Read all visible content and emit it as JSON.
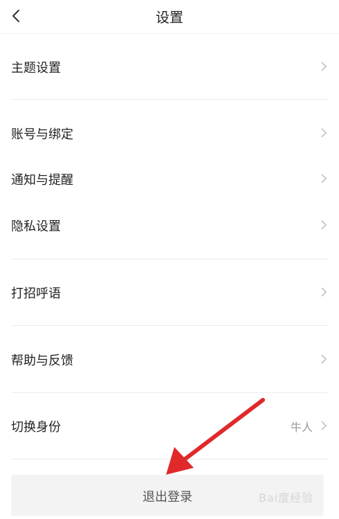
{
  "header": {
    "title": "设置",
    "back_icon": "back-chevron-icon"
  },
  "settings": {
    "theme": {
      "label": "主题设置"
    },
    "account": {
      "label": "账号与绑定"
    },
    "notify": {
      "label": "通知与提醒"
    },
    "privacy": {
      "label": "隐私设置"
    },
    "greeting": {
      "label": "打招呼语"
    },
    "help": {
      "label": "帮助与反馈"
    },
    "switch_identity": {
      "label": "切换身份",
      "value": "牛人"
    }
  },
  "logout": {
    "label": "退出登录"
  },
  "annotation": {
    "icon": "red-arrow-icon"
  },
  "watermark": {
    "text": "Bai度经验"
  },
  "colors": {
    "arrow": "#e0292a",
    "divider": "#ececec",
    "logout_bg": "#f3f3f3"
  }
}
